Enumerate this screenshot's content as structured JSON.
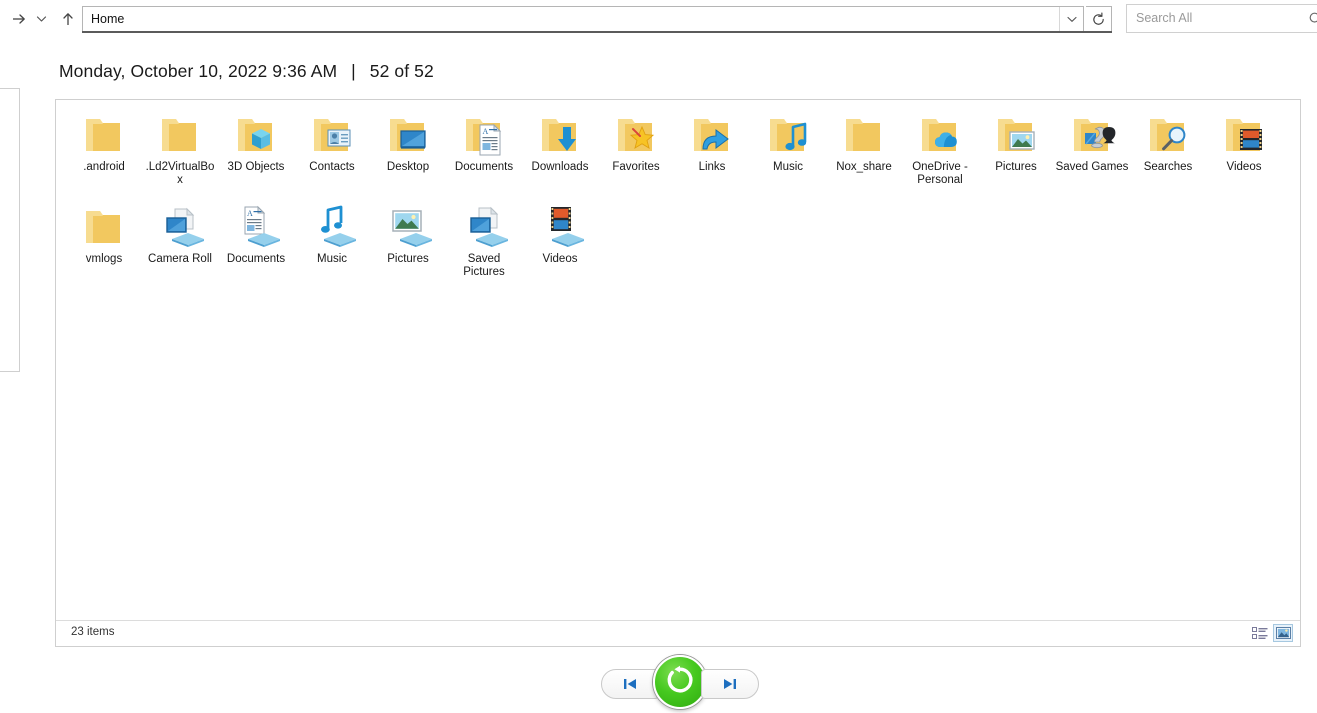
{
  "toolbar": {
    "forward_icon": "forward-arrow-icon",
    "history_icon": "chevron-down-icon",
    "up_icon": "up-arrow-icon",
    "address_value": "Home",
    "address_dropdown_icon": "chevron-down-icon",
    "refresh_icon": "refresh-icon",
    "refresh_glyph": "↻"
  },
  "search": {
    "value": "",
    "placeholder": "Search All",
    "icon": "search-icon"
  },
  "header": {
    "datetime": "Monday, October 10, 2022 9:36 AM",
    "separator": "|",
    "counter": "52 of 52"
  },
  "status": {
    "items_label": "23 items",
    "view_details_icon": "details-view-icon",
    "view_large_icons_icon": "large-icons-view-icon"
  },
  "version_bar": {
    "prev_label": "◀▐",
    "prev_name": "previous-version-button",
    "next_label": "▌▶",
    "next_name": "next-version-button",
    "restore_name": "restore-button",
    "restore_icon": "restore-circular-arrow-icon"
  },
  "colors": {
    "folder_body": "#f6d174",
    "folder_tab": "#ffe9a8",
    "accent_blue": "#1e90d2",
    "restore_green": "#46c91f",
    "toolbar_underline": "#5b5b5b",
    "panel_border": "#cfcfcf"
  },
  "items": [
    {
      "label": ".android",
      "icon": "folder-icon",
      "type": "folder"
    },
    {
      "label": ".Ld2VirtualBox",
      "icon": "folder-icon",
      "type": "folder"
    },
    {
      "label": "3D Objects",
      "icon": "folder-3d-objects-icon",
      "type": "folder"
    },
    {
      "label": "Contacts",
      "icon": "folder-contacts-icon",
      "type": "folder"
    },
    {
      "label": "Desktop",
      "icon": "folder-desktop-icon",
      "type": "folder"
    },
    {
      "label": "Documents",
      "icon": "folder-documents-icon",
      "type": "folder"
    },
    {
      "label": "Downloads",
      "icon": "folder-downloads-icon",
      "type": "folder"
    },
    {
      "label": "Favorites",
      "icon": "folder-favorites-icon",
      "type": "folder"
    },
    {
      "label": "Links",
      "icon": "folder-links-icon",
      "type": "folder"
    },
    {
      "label": "Music",
      "icon": "folder-music-icon",
      "type": "folder"
    },
    {
      "label": "Nox_share",
      "icon": "folder-icon",
      "type": "folder"
    },
    {
      "label": "OneDrive - Personal",
      "icon": "folder-onedrive-icon",
      "type": "folder"
    },
    {
      "label": "Pictures",
      "icon": "folder-pictures-icon",
      "type": "folder"
    },
    {
      "label": "Saved Games",
      "icon": "folder-saved-games-icon",
      "type": "folder"
    },
    {
      "label": "Searches",
      "icon": "folder-searches-icon",
      "type": "folder"
    },
    {
      "label": "Videos",
      "icon": "folder-videos-icon",
      "type": "folder"
    },
    {
      "label": "vmlogs",
      "icon": "folder-icon",
      "type": "folder"
    },
    {
      "label": "Camera Roll",
      "icon": "library-camera-roll-icon",
      "type": "library"
    },
    {
      "label": "Documents",
      "icon": "library-documents-icon",
      "type": "library"
    },
    {
      "label": "Music",
      "icon": "library-music-icon",
      "type": "library"
    },
    {
      "label": "Pictures",
      "icon": "library-pictures-icon",
      "type": "library"
    },
    {
      "label": "Saved Pictures",
      "icon": "library-saved-pictures-icon",
      "type": "library"
    },
    {
      "label": "Videos",
      "icon": "library-videos-icon",
      "type": "library"
    }
  ]
}
